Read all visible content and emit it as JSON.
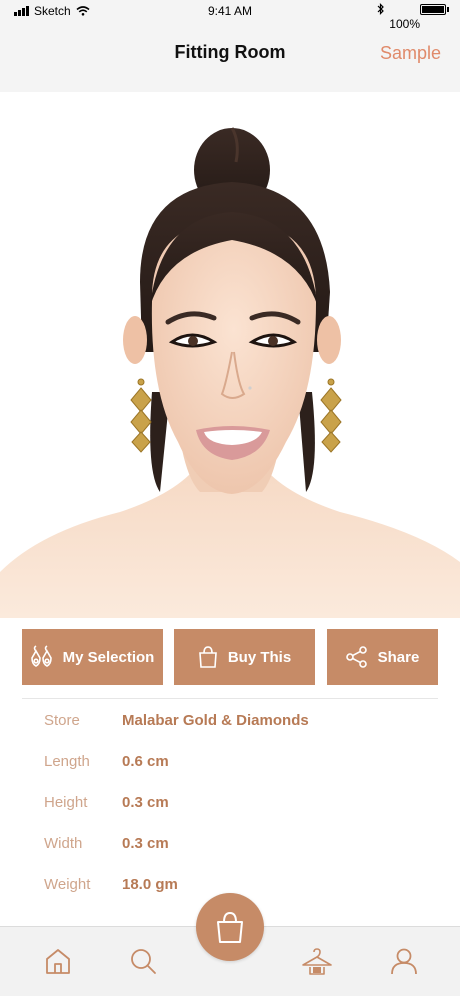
{
  "status_bar": {
    "carrier": "Sketch",
    "time": "9:41 AM",
    "battery": "100%"
  },
  "nav": {
    "title": "Fitting Room",
    "action": "Sample"
  },
  "actions": [
    {
      "label": "My Selection",
      "icon": "earrings-icon"
    },
    {
      "label": "Buy This",
      "icon": "shopping-bag-icon"
    },
    {
      "label": "Share",
      "icon": "share-icon"
    }
  ],
  "details": [
    {
      "label": "Store",
      "value": "Malabar Gold & Diamonds"
    },
    {
      "label": "Length",
      "value": "0.6 cm"
    },
    {
      "label": "Height",
      "value": "0.3 cm"
    },
    {
      "label": "Width",
      "value": "0.3 cm"
    },
    {
      "label": "Weight",
      "value": "18.0 gm"
    }
  ],
  "tabs": [
    "home-icon",
    "search-icon",
    "shopping-bag-icon",
    "wardrobe-hanger-icon",
    "profile-icon"
  ],
  "colors": {
    "accent": "#c68b67",
    "nav_action": "#e08a6a",
    "detail_label": "#cfa58c",
    "detail_value": "#b77a55"
  }
}
